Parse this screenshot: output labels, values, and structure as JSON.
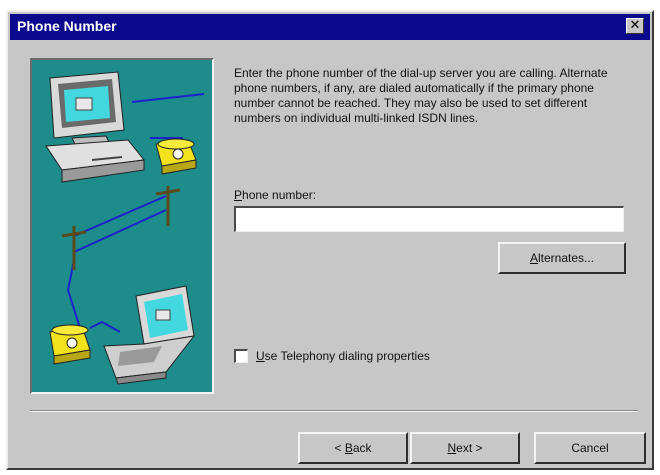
{
  "window": {
    "title": "Phone Number",
    "close_glyph": "✕"
  },
  "illustration": {
    "description_icons": [
      "computer-icon",
      "telephone-icon",
      "telephone-pole-icon",
      "laptop-icon"
    ],
    "background_color": "#1f8c8c"
  },
  "content": {
    "description": "Enter the phone number of the dial-up server you are calling.  Alternate phone numbers, if any, are dialed automatically if the primary phone number cannot be reached.  They may also be used to set different numbers on individual multi-linked ISDN lines.",
    "phone_label_mnemonic": "P",
    "phone_label_rest": "hone number:",
    "phone_value": "",
    "alternates_mnemonic": "A",
    "alternates_rest": "lternates...",
    "checkbox_mnemonic": "U",
    "checkbox_rest": "se Telephony dialing properties",
    "checkbox_checked": false
  },
  "footer": {
    "back_prefix": "< ",
    "back_mnemonic": "B",
    "back_rest": "ack",
    "next_mnemonic": "N",
    "next_rest": "ext >",
    "cancel_label": "Cancel"
  },
  "colors": {
    "titlebar": "#0c0a8c",
    "dialog_face": "#c7c7c7",
    "accent_teal": "#1f8c8c"
  }
}
